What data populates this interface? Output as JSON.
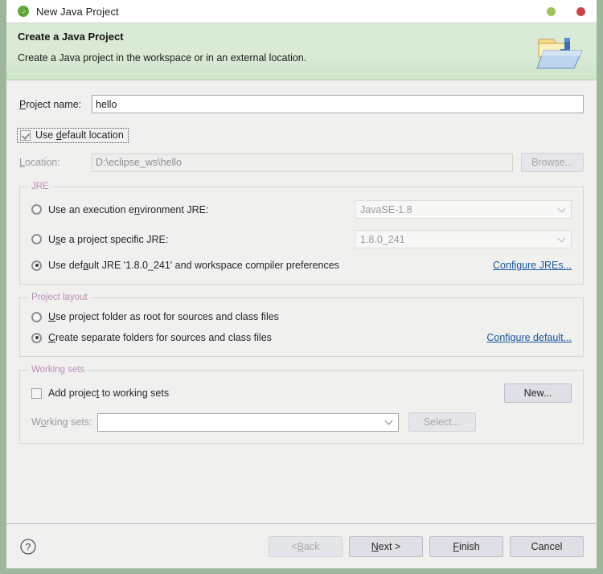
{
  "window": {
    "title": "New Java Project",
    "app_icon": "java-project-icon",
    "controls": [
      {
        "name": "minimize-button",
        "color": "#9fc25b"
      },
      {
        "name": "close-button",
        "color": "#c9434a"
      }
    ],
    "border_color": "#9db69c"
  },
  "header": {
    "title": "Create a Java Project",
    "subtitle": "Create a Java project in the workspace or in an external location.",
    "icon": "java-project-folder-icon",
    "bg_color": "#d9ebd6"
  },
  "form": {
    "project_name": {
      "label": "Project name:",
      "label_mnemonic": "P",
      "value": "hello",
      "placeholder": ""
    },
    "use_default_location": {
      "label": "Use default location",
      "label_mnemonic": "d",
      "checked": true,
      "focused": true
    },
    "location": {
      "label": "Location:",
      "label_mnemonic": "L",
      "value": "D:\\eclipse_ws\\hello",
      "enabled": false,
      "browse_label": "Browse...",
      "browse_enabled": false
    }
  },
  "jre": {
    "group_title": "JRE",
    "group_title_color": "#b68fb0",
    "options": [
      {
        "label": "Use an execution environment JRE:",
        "label_mnemonic": "n",
        "selected": false,
        "combo_value": "JavaSE-1.8",
        "combo_enabled": false
      },
      {
        "label": "Use a project specific JRE:",
        "label_mnemonic": "s",
        "selected": false,
        "combo_value": "1.8.0_241",
        "combo_enabled": false
      },
      {
        "label": "Use default JRE '1.8.0_241' and workspace compiler preferences",
        "label_mnemonic": "a",
        "selected": true,
        "combo_value": "",
        "combo_enabled": false
      }
    ],
    "configure_link": "Configure JREs...",
    "link_color": "#18559c"
  },
  "project_layout": {
    "group_title": "Project layout",
    "options": [
      {
        "label": "Use project folder as root for sources and class files",
        "label_mnemonic": "U",
        "selected": false
      },
      {
        "label": "Create separate folders for sources and class files",
        "label_mnemonic": "C",
        "selected": true
      }
    ],
    "configure_link": "Configure default..."
  },
  "working_sets": {
    "group_title": "Working sets",
    "add_checkbox": {
      "label": "Add project to working sets",
      "label_mnemonic": "t",
      "checked": false
    },
    "new_button": {
      "label": "New...",
      "enabled": true
    },
    "sets_label": "Working sets:",
    "sets_label_mnemonic": "o",
    "sets_value": "",
    "sets_enabled": true,
    "select_button": {
      "label": "Select...",
      "enabled": false
    }
  },
  "footer": {
    "help_icon": "help-question-icon",
    "buttons": [
      {
        "label": "< Back",
        "mnemonic": "B",
        "enabled": false,
        "name": "back-button"
      },
      {
        "label": "Next >",
        "mnemonic": "N",
        "enabled": true,
        "name": "next-button"
      },
      {
        "label": "Finish",
        "mnemonic": "F",
        "enabled": true,
        "name": "finish-button"
      },
      {
        "label": "Cancel",
        "mnemonic": "",
        "enabled": true,
        "name": "cancel-button"
      }
    ]
  }
}
